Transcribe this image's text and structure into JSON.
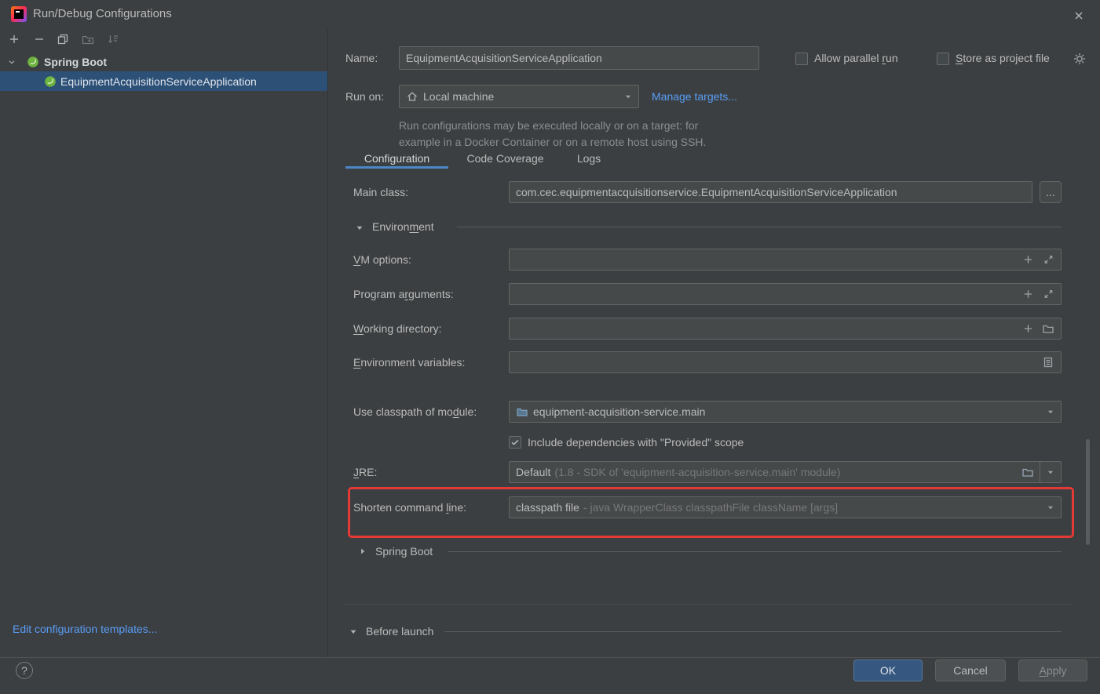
{
  "titlebar": {
    "title": "Run/Debug Configurations"
  },
  "sidebar": {
    "group_label": "Spring Boot",
    "item_label": "EquipmentAcquisitionServiceApplication",
    "edit_templates": "Edit configuration templates..."
  },
  "form": {
    "name_label": "Name:",
    "name_value": "EquipmentAcquisitionServiceApplication",
    "allow_parallel_label": {
      "text": "Allow parallel run",
      "mn": 15
    },
    "store_project_label": {
      "text": "Store as project file",
      "mn": 0
    },
    "run_on_label": "Run on:",
    "run_on_value": "Local machine",
    "manage_targets": "Manage targets...",
    "help_line1": "Run configurations may be executed locally or on a target: for",
    "help_line2": "example in a Docker Container or on a remote host using SSH.",
    "tabs": [
      {
        "label": "Configuration"
      },
      {
        "label": "Code Coverage"
      },
      {
        "label": "Logs"
      }
    ]
  },
  "config": {
    "main_class_label": "Main class:",
    "main_class_value": "com.cec.equipmentacquisitionservice.EquipmentAcquisitionServiceApplication",
    "browse_label": "...",
    "environment_header": {
      "text": "Environment",
      "mn": 7
    },
    "vm_options_label": {
      "text": "VM options:",
      "mn": 0
    },
    "program_arguments_label": {
      "text": "Program arguments:",
      "mn": 9
    },
    "working_directory_label": {
      "text": "Working directory:",
      "mn": 0
    },
    "environment_variables_label": {
      "text": "Environment variables:",
      "mn": 0
    },
    "classpath_label": {
      "text": "Use classpath of module:",
      "mn": 19
    },
    "classpath_value": "equipment-acquisition-service.main",
    "provided_scope_label": "Include dependencies with \"Provided\" scope",
    "jre_label": {
      "text": "JRE:",
      "mn": 0
    },
    "jre_value": "Default",
    "jre_hint": "(1.8 - SDK of 'equipment-acquisition-service.main' module)",
    "shorten_label": {
      "text": "Shorten command line:",
      "mn": 16
    },
    "shorten_value": "classpath file",
    "shorten_hint": "- java WrapperClass classpathFile className [args]",
    "spring_boot_header": "Spring Boot",
    "before_launch_header": "Before launch"
  },
  "footer": {
    "ok": "OK",
    "cancel": "Cancel",
    "apply": {
      "text": "Apply",
      "mn": 0
    },
    "help": "?"
  },
  "icons": {
    "add": "plus",
    "remove": "minus",
    "copy": "two-overlapping-pages",
    "move-to-folder": "folder-with-arrow",
    "sort": "arrow-down-with-lines",
    "tree-expander": "chevron-down",
    "spring": "green-spring-leaf-circle",
    "close": "x",
    "local-machine": "house",
    "settings": "gear",
    "field-add": "plus",
    "field-expand": "diagonal-resize-arrows",
    "browse-folder": "folder",
    "env-vars": "list-document",
    "module": "blue-folder",
    "dropdown": "triangle-down",
    "section-expanded": "triangle-down",
    "section-collapsed": "triangle-right",
    "checked": "checkmark"
  },
  "colors": {
    "accent": "#4a88c7",
    "link": "#589df6",
    "selection": "#2d5077",
    "annotation": "#e53935",
    "spring_green": "#6db33f",
    "primary_button": "#365880",
    "field_bg": "#45494a",
    "window_bg": "#3c3f41"
  }
}
